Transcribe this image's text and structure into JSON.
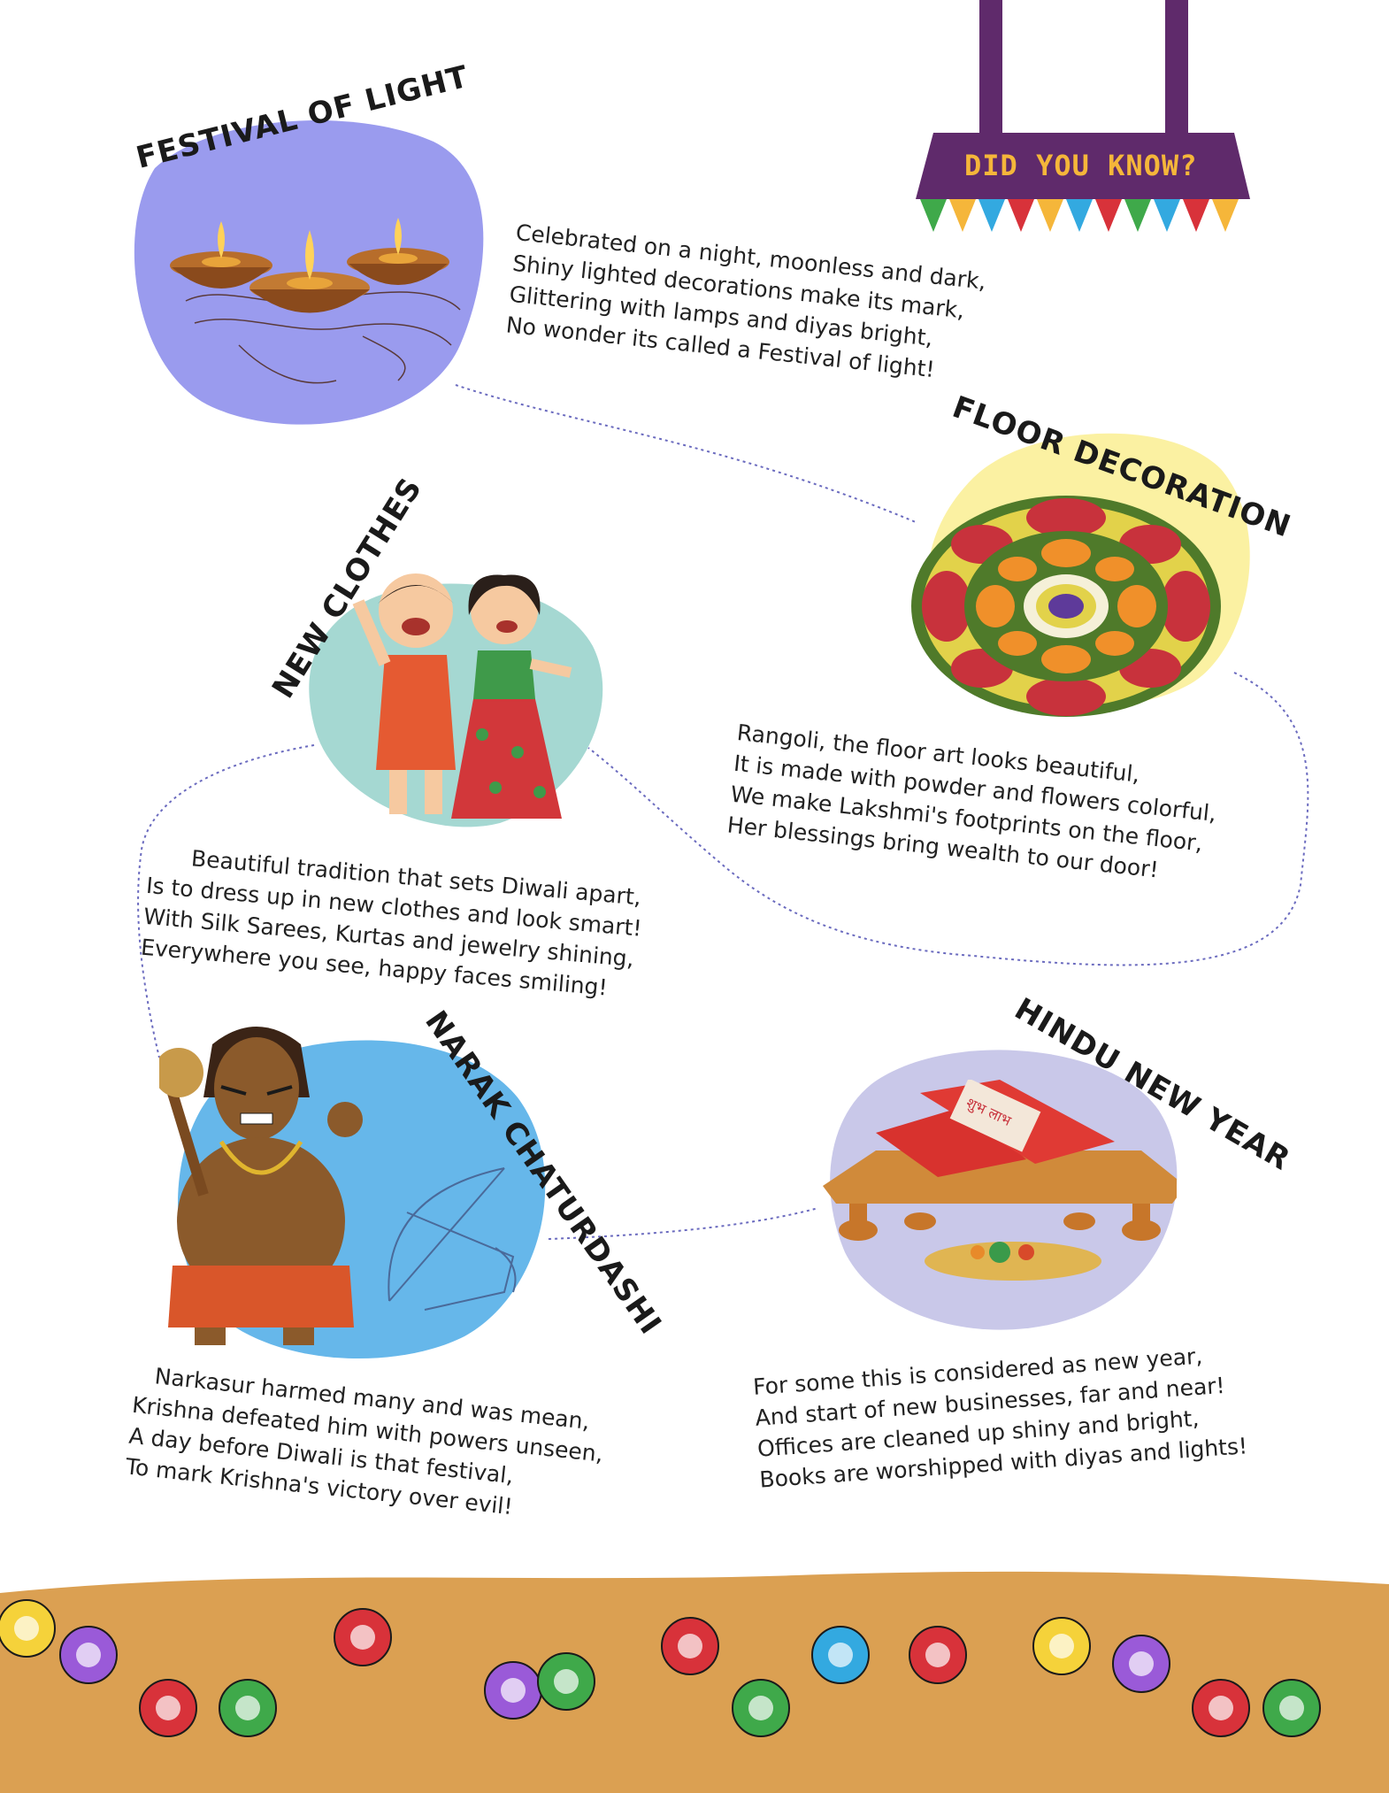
{
  "did_you_know": {
    "label": "DID YOU KNOW?"
  },
  "sections": [
    {
      "title": "FESTIVAL OF LIGHT",
      "lines": [
        "Celebrated on a night, moonless and dark,",
        "Shiny lighted decorations make its mark,",
        "Glittering with lamps and diyas bright,",
        "No wonder its called a Festival of light!"
      ]
    },
    {
      "title": "FLOOR DECORATION",
      "lines": [
        "Rangoli, the floor art looks beautiful,",
        "It is made with powder and flowers colorful,",
        "We make Lakshmi's footprints on the floor,",
        "Her blessings bring wealth to our door!"
      ]
    },
    {
      "title": "NEW CLOTHES",
      "lines": [
        "Beautiful tradition that sets Diwali apart,",
        "Is to dress up in new clothes and look smart!",
        "With Silk Sarees, Kurtas and jewelry shining,",
        "Everywhere you see, happy faces smiling!"
      ]
    },
    {
      "title": "NARAK CHATURDASHI",
      "lines": [
        "Narkasur harmed many and was mean,",
        "Krishna defeated him with powers unseen,",
        "A day before Diwali is that festival,",
        "To mark Krishna's victory over evil!"
      ]
    },
    {
      "title": "HINDU NEW YEAR",
      "lines": [
        "For some this is considered as new year,",
        "And start of new businesses, far and near!",
        "Offices are cleaned up shiny and bright,",
        "Books are worshipped with diyas and lights!"
      ]
    }
  ],
  "book_label": "शुभ लाभ",
  "colors": {
    "purple": "#5f2a6b",
    "light_purple": "#9a9bee",
    "yellow": "#fbf1a2",
    "teal": "#a5d8d2",
    "blue": "#66b7ea",
    "lavender": "#c9c8e9",
    "ground": "#dba052"
  }
}
